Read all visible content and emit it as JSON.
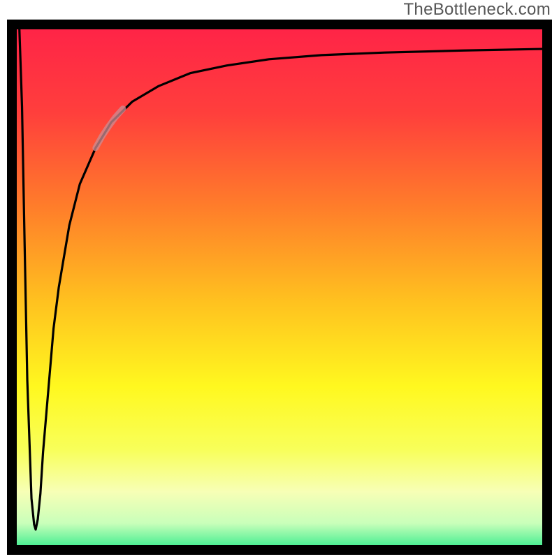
{
  "watermark": "TheBottleneck.com",
  "colors": {
    "frame": "#000000",
    "curve_main": "#000000",
    "curve_accent": "#CC8E94",
    "gradient_stops": [
      {
        "pos": 0.0,
        "color": "#FF2447"
      },
      {
        "pos": 0.16,
        "color": "#FF3F3C"
      },
      {
        "pos": 0.34,
        "color": "#FF7E2A"
      },
      {
        "pos": 0.52,
        "color": "#FFC21F"
      },
      {
        "pos": 0.68,
        "color": "#FFF81F"
      },
      {
        "pos": 0.8,
        "color": "#F8FF5A"
      },
      {
        "pos": 0.88,
        "color": "#F7FFB6"
      },
      {
        "pos": 0.94,
        "color": "#C9FFBA"
      },
      {
        "pos": 1.0,
        "color": "#17E884"
      }
    ]
  },
  "chart_data": {
    "type": "line",
    "title": "",
    "xlabel": "",
    "ylabel": "",
    "xlim": [
      0,
      100
    ],
    "ylim": [
      0,
      100
    ],
    "grid": false,
    "legend": false,
    "series": [
      {
        "name": "primary-curve",
        "x": [
          0.5,
          1.0,
          1.5,
          2.0,
          2.8,
          3.3,
          3.6,
          4.0,
          4.5,
          5.0,
          6.0,
          7.0,
          8.0,
          10.0,
          12.0,
          15.0,
          18.0,
          22.0,
          27.0,
          33.0,
          40.0,
          48.0,
          58.0,
          70.0,
          85.0,
          100.0
        ],
        "y": [
          100,
          85,
          58,
          32,
          9,
          4,
          3,
          5,
          10,
          18,
          30,
          42,
          50,
          62,
          70,
          77,
          82,
          86,
          89,
          91.5,
          93.0,
          94.2,
          95.0,
          95.5,
          95.9,
          96.2
        ]
      },
      {
        "name": "accent-segment",
        "x": [
          15.0,
          16.2,
          17.5,
          18.8,
          20.2
        ],
        "y": [
          77.0,
          79.2,
          81.2,
          83.0,
          84.6
        ]
      }
    ],
    "annotations": []
  }
}
